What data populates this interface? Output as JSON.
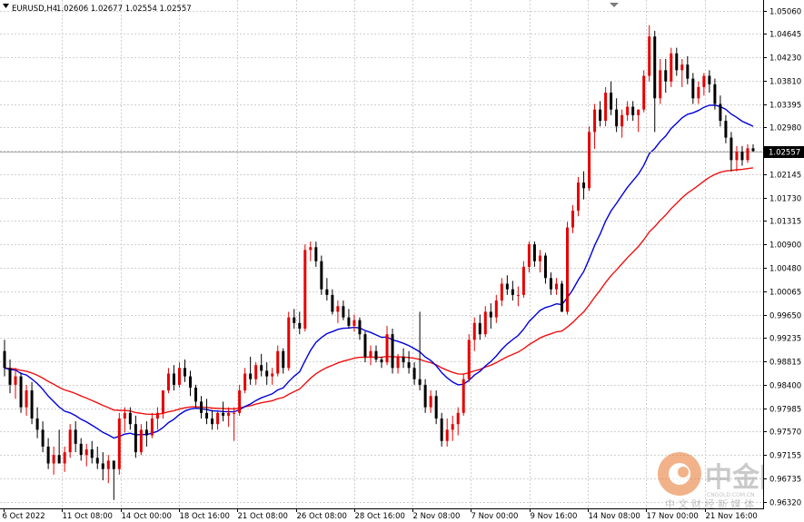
{
  "header": {
    "symbol_text": "EURUSD,H4",
    "ohlc_text": "1.02606 1.02677 1.02554 1.02557"
  },
  "watermark": {
    "brand_text": "中金网",
    "subtitle_text": "中 文 财 经 新 媒 体",
    "domain_text": "CNGOLD.COM.CN",
    "accent_color": "#e8742a"
  },
  "colors": {
    "bull": "#e50000",
    "bear": "#000000",
    "ma_fast": "#0000dd",
    "ma_slow": "#ee1111",
    "grid": "#d0d0d0",
    "current_line": "#a9a9a9"
  },
  "chart_data": {
    "type": "candlestick",
    "symbol": "EURUSD",
    "timeframe": "H4",
    "x_labels": [
      "6 Oct 2022",
      "11 Oct 08:00",
      "14 Oct 00:00",
      "18 Oct 16:00",
      "21 Oct 08:00",
      "26 Oct 08:00",
      "28 Oct 16:00",
      "2 Nov 08:00",
      "7 Nov 00:00",
      "9 Nov 16:00",
      "14 Nov 08:00",
      "17 Nov 00:00",
      "21 Nov 16:00"
    ],
    "y_ticks": [
      "1.05060",
      "1.04645",
      "1.04230",
      "1.03810",
      "1.03395",
      "1.02980",
      "1.02560",
      "1.02145",
      "1.01730",
      "1.01315",
      "1.00900",
      "1.00480",
      "1.00065",
      "0.99650",
      "0.99235",
      "0.98815",
      "0.98400",
      "0.97985",
      "0.97570",
      "0.97155",
      "0.96735",
      "0.96320"
    ],
    "ylim": [
      0.962,
      1.0525
    ],
    "current_price": "1.02557",
    "current_value": 1.02557,
    "grid": true,
    "candles": [
      [
        0.99,
        0.992,
        0.9855,
        0.987
      ],
      [
        0.987,
        0.9885,
        0.9825,
        0.984
      ],
      [
        0.984,
        0.987,
        0.9815,
        0.9855
      ],
      [
        0.9855,
        0.9862,
        0.979,
        0.98
      ],
      [
        0.98,
        0.984,
        0.9785,
        0.983
      ],
      [
        0.983,
        0.9845,
        0.977,
        0.978
      ],
      [
        0.978,
        0.98,
        0.9745,
        0.976
      ],
      [
        0.976,
        0.9775,
        0.972,
        0.973
      ],
      [
        0.973,
        0.9745,
        0.969,
        0.97
      ],
      [
        0.97,
        0.973,
        0.968,
        0.9715
      ],
      [
        0.9715,
        0.976,
        0.97,
        0.97
      ],
      [
        0.97,
        0.973,
        0.9685,
        0.972
      ],
      [
        0.972,
        0.977,
        0.971,
        0.976
      ],
      [
        0.976,
        0.9775,
        0.972,
        0.9735
      ],
      [
        0.9735,
        0.9745,
        0.9705,
        0.9715
      ],
      [
        0.9715,
        0.9735,
        0.9695,
        0.9725
      ],
      [
        0.9725,
        0.974,
        0.97,
        0.971
      ],
      [
        0.971,
        0.973,
        0.969,
        0.97
      ],
      [
        0.97,
        0.972,
        0.967,
        0.969
      ],
      [
        0.969,
        0.9715,
        0.9665,
        0.9705
      ],
      [
        0.9705,
        0.9705,
        0.9635,
        0.969
      ],
      [
        0.969,
        0.979,
        0.968,
        0.978
      ],
      [
        0.978,
        0.98,
        0.9755,
        0.979
      ],
      [
        0.979,
        0.98,
        0.976,
        0.977
      ],
      [
        0.977,
        0.9785,
        0.971,
        0.972
      ],
      [
        0.972,
        0.977,
        0.9715,
        0.976
      ],
      [
        0.976,
        0.9775,
        0.973,
        0.975
      ],
      [
        0.975,
        0.979,
        0.9745,
        0.978
      ],
      [
        0.978,
        0.98,
        0.976,
        0.979
      ],
      [
        0.979,
        0.983,
        0.978,
        0.983
      ],
      [
        0.983,
        0.987,
        0.9825,
        0.986
      ],
      [
        0.986,
        0.9875,
        0.983,
        0.984
      ],
      [
        0.984,
        0.988,
        0.9835,
        0.987
      ],
      [
        0.987,
        0.9885,
        0.9845,
        0.9855
      ],
      [
        0.9855,
        0.9865,
        0.982,
        0.9835
      ],
      [
        0.9835,
        0.984,
        0.98,
        0.981
      ],
      [
        0.981,
        0.982,
        0.978,
        0.979
      ],
      [
        0.979,
        0.9815,
        0.977,
        0.978
      ],
      [
        0.978,
        0.9795,
        0.976,
        0.977
      ],
      [
        0.977,
        0.9795,
        0.976,
        0.979
      ],
      [
        0.979,
        0.981,
        0.9775,
        0.9785
      ],
      [
        0.9785,
        0.98,
        0.9765,
        0.979
      ],
      [
        0.979,
        0.98,
        0.974,
        0.979
      ],
      [
        0.979,
        0.984,
        0.9785,
        0.983
      ],
      [
        0.983,
        0.987,
        0.9825,
        0.986
      ],
      [
        0.986,
        0.989,
        0.984,
        0.985
      ],
      [
        0.985,
        0.988,
        0.984,
        0.9875
      ],
      [
        0.9875,
        0.9895,
        0.9855,
        0.9865
      ],
      [
        0.9865,
        0.988,
        0.984,
        0.9855
      ],
      [
        0.9855,
        0.987,
        0.984,
        0.986
      ],
      [
        0.986,
        0.991,
        0.9855,
        0.99
      ],
      [
        0.99,
        0.9905,
        0.986,
        0.987
      ],
      [
        0.987,
        0.997,
        0.9865,
        0.996
      ],
      [
        0.996,
        0.9975,
        0.994,
        0.995
      ],
      [
        0.995,
        0.997,
        0.993,
        0.994
      ],
      [
        0.994,
        1.009,
        0.9935,
        1.008
      ],
      [
        1.008,
        1.0095,
        1.006,
        1.0085
      ],
      [
        1.0085,
        1.0095,
        1.005,
        1.006
      ],
      [
        1.006,
        1.007,
        1.0,
        1.001
      ],
      [
        1.001,
        1.003,
        0.999,
        1.0
      ],
      [
        1.0,
        1.001,
        0.9965,
        0.997
      ],
      [
        0.997,
        0.999,
        0.995,
        0.998
      ],
      [
        0.998,
        0.999,
        0.9955,
        0.996
      ],
      [
        0.996,
        0.9975,
        0.994,
        0.9945
      ],
      [
        0.9945,
        0.9965,
        0.9935,
        0.9955
      ],
      [
        0.9955,
        0.996,
        0.992,
        0.993
      ],
      [
        0.993,
        0.9935,
        0.988,
        0.989
      ],
      [
        0.989,
        0.991,
        0.9875,
        0.99
      ],
      [
        0.99,
        0.991,
        0.988,
        0.9885
      ],
      [
        0.9885,
        0.989,
        0.987,
        0.988
      ],
      [
        0.988,
        0.9945,
        0.9875,
        0.993
      ],
      [
        0.993,
        0.994,
        0.986,
        0.987
      ],
      [
        0.987,
        0.9895,
        0.986,
        0.989
      ],
      [
        0.989,
        0.9905,
        0.987,
        0.988
      ],
      [
        0.988,
        0.99,
        0.986,
        0.987
      ],
      [
        0.987,
        0.988,
        0.984,
        0.985
      ],
      [
        0.985,
        0.997,
        0.983,
        0.984
      ],
      [
        0.984,
        0.985,
        0.979,
        0.98
      ],
      [
        0.98,
        0.983,
        0.979,
        0.982
      ],
      [
        0.982,
        0.983,
        0.977,
        0.978
      ],
      [
        0.978,
        0.979,
        0.973,
        0.974
      ],
      [
        0.974,
        0.978,
        0.973,
        0.976
      ],
      [
        0.976,
        0.9785,
        0.974,
        0.977
      ],
      [
        0.977,
        0.98,
        0.975,
        0.979
      ],
      [
        0.979,
        0.986,
        0.9785,
        0.985
      ],
      [
        0.985,
        0.993,
        0.9845,
        0.992
      ],
      [
        0.992,
        0.996,
        0.99,
        0.995
      ],
      [
        0.995,
        0.9965,
        0.992,
        0.993
      ],
      [
        0.993,
        0.998,
        0.9925,
        0.997
      ],
      [
        0.997,
        0.9985,
        0.994,
        0.996
      ],
      [
        0.996,
        1.0,
        0.995,
        0.999
      ],
      [
        0.999,
        1.003,
        0.998,
        1.002
      ],
      [
        1.002,
        1.0035,
        1.0,
        1.001
      ],
      [
        1.001,
        1.0025,
        0.999,
        1.0
      ],
      [
        1.0,
        1.0015,
        0.998,
        1.0
      ],
      [
        1.0,
        1.006,
        0.9995,
        1.005
      ],
      [
        1.005,
        1.0095,
        1.004,
        1.009
      ],
      [
        1.009,
        1.0095,
        1.005,
        1.006
      ],
      [
        1.006,
        1.008,
        1.004,
        1.007
      ],
      [
        1.007,
        1.0075,
        1.002,
        1.003
      ],
      [
        1.003,
        1.004,
        1.0,
        1.001
      ],
      [
        1.001,
        1.003,
        1.0,
        1.002
      ],
      [
        1.002,
        1.0025,
        0.997,
        0.997
      ],
      [
        0.997,
        1.013,
        0.9965,
        1.012
      ],
      [
        1.012,
        1.016,
        1.011,
        1.015
      ],
      [
        1.015,
        1.021,
        1.014,
        1.02
      ],
      [
        1.02,
        1.022,
        1.017,
        1.019
      ],
      [
        1.019,
        1.03,
        1.0185,
        1.029
      ],
      [
        1.029,
        1.034,
        1.026,
        1.033
      ],
      [
        1.033,
        1.0345,
        1.03,
        1.031
      ],
      [
        1.031,
        1.037,
        1.03,
        1.036
      ],
      [
        1.036,
        1.038,
        1.032,
        1.033
      ],
      [
        1.033,
        1.035,
        1.029,
        1.03
      ],
      [
        1.03,
        1.033,
        1.028,
        1.032
      ],
      [
        1.032,
        1.0345,
        1.031,
        1.0335
      ],
      [
        1.0335,
        1.0345,
        1.031,
        1.032
      ],
      [
        1.032,
        1.033,
        1.029,
        1.033
      ],
      [
        1.033,
        1.04,
        1.0325,
        1.039
      ],
      [
        1.039,
        1.048,
        1.038,
        1.046
      ],
      [
        1.046,
        1.047,
        1.029,
        1.035
      ],
      [
        1.035,
        1.042,
        1.034,
        1.04
      ],
      [
        1.04,
        1.042,
        1.036,
        1.038
      ],
      [
        1.038,
        1.044,
        1.037,
        1.043
      ],
      [
        1.043,
        1.044,
        1.039,
        1.04
      ],
      [
        1.04,
        1.042,
        1.037,
        1.041
      ],
      [
        1.041,
        1.0425,
        1.0375,
        1.0385
      ],
      [
        1.0385,
        1.0395,
        1.034,
        1.035
      ],
      [
        1.035,
        1.038,
        1.034,
        1.037
      ],
      [
        1.037,
        1.0395,
        1.0355,
        1.039
      ],
      [
        1.039,
        1.04,
        1.036,
        1.0375
      ],
      [
        1.0375,
        1.0385,
        1.033,
        1.034
      ],
      [
        1.034,
        1.0355,
        1.03,
        1.031
      ],
      [
        1.031,
        1.032,
        1.027,
        1.028
      ],
      [
        1.028,
        1.029,
        1.022,
        1.024
      ],
      [
        1.024,
        1.0265,
        1.022,
        1.0255
      ],
      [
        1.0255,
        1.0265,
        1.023,
        1.024
      ],
      [
        1.024,
        1.0268,
        1.0235,
        1.0261
      ],
      [
        1.0261,
        1.0268,
        1.0255,
        1.0256
      ]
    ],
    "series": [
      {
        "type": "ma"
      },
      {
        "type": "ma"
      }
    ]
  }
}
